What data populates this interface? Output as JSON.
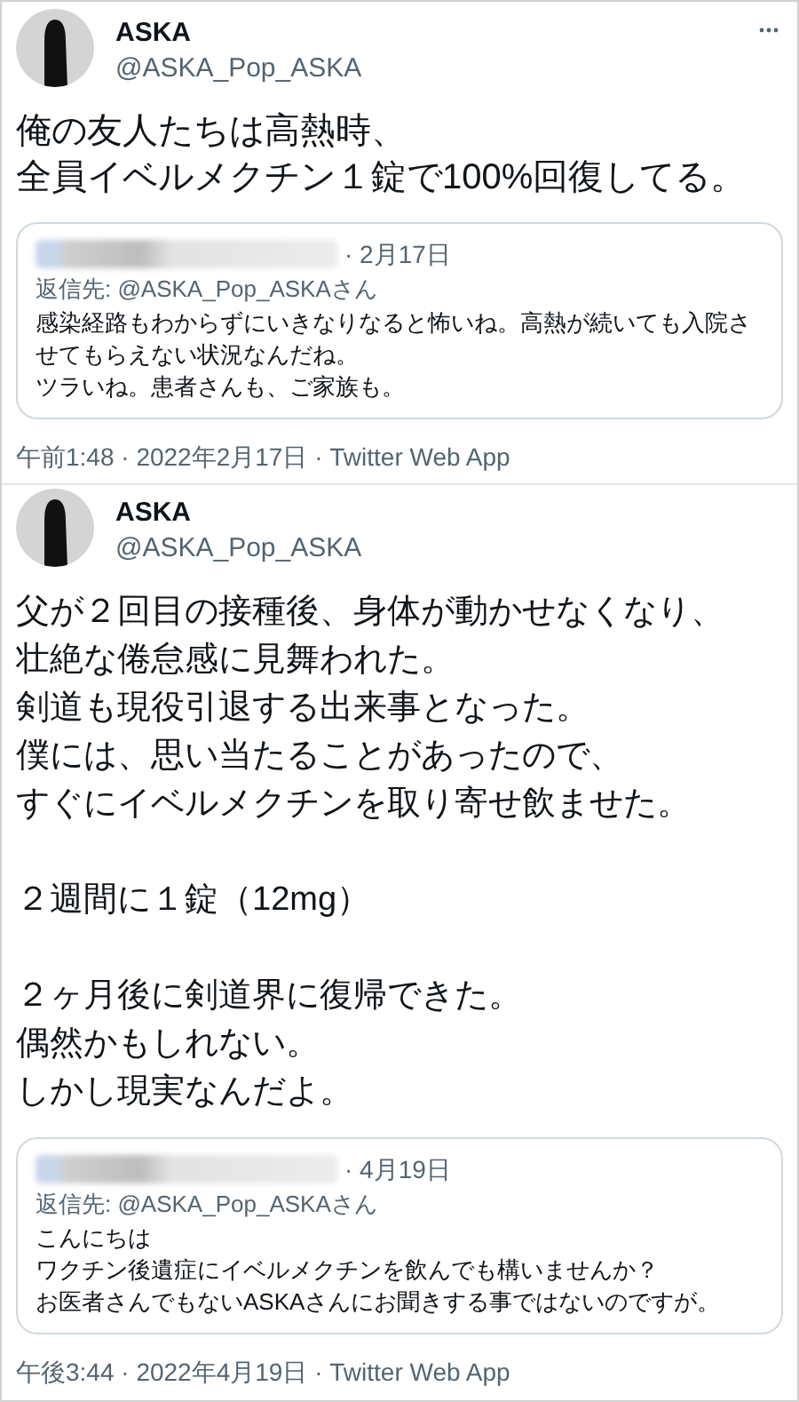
{
  "tweets": [
    {
      "name": "ASKA",
      "handle": "@ASKA_Pop_ASKA",
      "paragraphs": [
        [
          "俺の友人たちは高熱時、",
          "全員イベルメクチン１錠で100%回復してる。"
        ]
      ],
      "quote": {
        "date": "· 2月17日",
        "reply_to": "返信先: @ASKA_Pop_ASKAさん",
        "lines": [
          "感染経路もわからずにいきなりなると怖いね。高熱が続いても入院させてもらえない状況なんだね。",
          "ツラいね。患者さんも、ご家族も。"
        ]
      },
      "footer": "午前1:48 · 2022年2月17日 · Twitter Web App"
    },
    {
      "name": "ASKA",
      "handle": "@ASKA_Pop_ASKA",
      "paragraphs": [
        [
          "父が２回目の接種後、身体が動かせなくなり、",
          "壮絶な倦怠感に見舞われた。",
          "剣道も現役引退する出来事となった。",
          "僕には、思い当たることがあったので、",
          "すぐにイベルメクチンを取り寄せ飲ませた。"
        ],
        [
          "２週間に１錠（12mg）"
        ],
        [
          "２ヶ月後に剣道界に復帰できた。",
          "偶然かもしれない。",
          "しかし現実なんだよ。"
        ]
      ],
      "quote": {
        "date": "· 4月19日",
        "reply_to": "返信先: @ASKA_Pop_ASKAさん",
        "lines": [
          "こんにちは",
          "ワクチン後遺症にイベルメクチンを飲んでも構いませんか？",
          "お医者さんでもないASKAさんにお聞きする事ではないのですが。"
        ]
      },
      "footer": "午後3:44 · 2022年4月19日 · Twitter Web App"
    }
  ]
}
